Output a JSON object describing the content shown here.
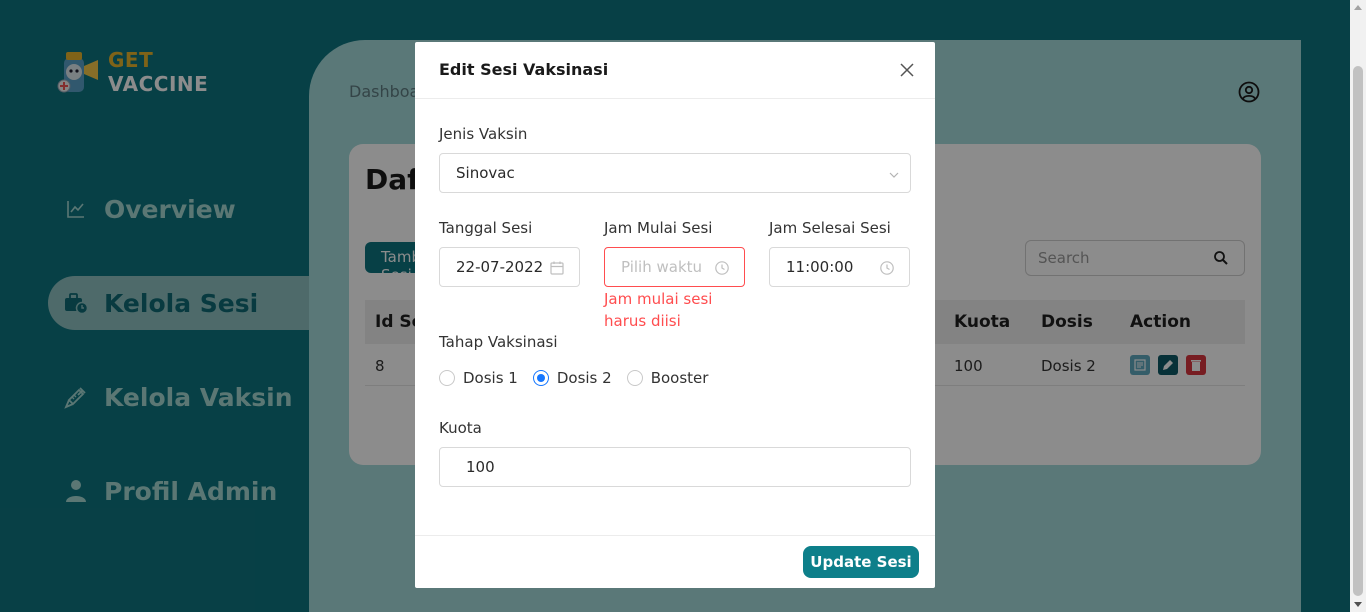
{
  "app": {
    "logo_get": "GET",
    "logo_vaccine": "VACCINE"
  },
  "sidebar": {
    "items": [
      {
        "label": "Overview",
        "icon": "line-chart-icon"
      },
      {
        "label": "Kelola Sesi",
        "icon": "briefcase-clock-icon"
      },
      {
        "label": "Kelola Vaksin",
        "icon": "syringe-icon"
      },
      {
        "label": "Profil Admin",
        "icon": "user-icon"
      }
    ],
    "active_index": 1
  },
  "main": {
    "breadcrumb": "Dashboard",
    "card_title": "Daftar Sesi",
    "add_button": "Tambah Sesi",
    "search_placeholder": "Search",
    "table": {
      "headers": [
        "Id Sesi",
        "Kuota",
        "Dosis",
        "Action"
      ],
      "rows": [
        {
          "id": "8",
          "kuota": "100",
          "dosis": "Dosis 2"
        }
      ]
    }
  },
  "modal": {
    "title": "Edit Sesi Vaksinasi",
    "jenis_label": "Jenis Vaksin",
    "jenis_value": "Sinovac",
    "tanggal_label": "Tanggal Sesi",
    "tanggal_value": "22-07-2022",
    "mulai_label": "Jam Mulai Sesi",
    "mulai_placeholder": "Pilih waktu",
    "mulai_error": "Jam mulai sesi harus diisi",
    "selesai_label": "Jam Selesai Sesi",
    "selesai_value": "11:00:00",
    "tahap_label": "Tahap Vaksinasi",
    "tahap_options": [
      "Dosis 1",
      "Dosis 2",
      "Booster"
    ],
    "tahap_selected": "Dosis 2",
    "kuota_label": "Kuota",
    "kuota_value": "100",
    "submit_label": "Update Sesi"
  },
  "colors": {
    "primary": "#0e7580",
    "sidebar_bg": "#025259",
    "error": "#ff4d4f",
    "radio_active": "#1677ff",
    "logo_gold": "#e8b52d"
  }
}
